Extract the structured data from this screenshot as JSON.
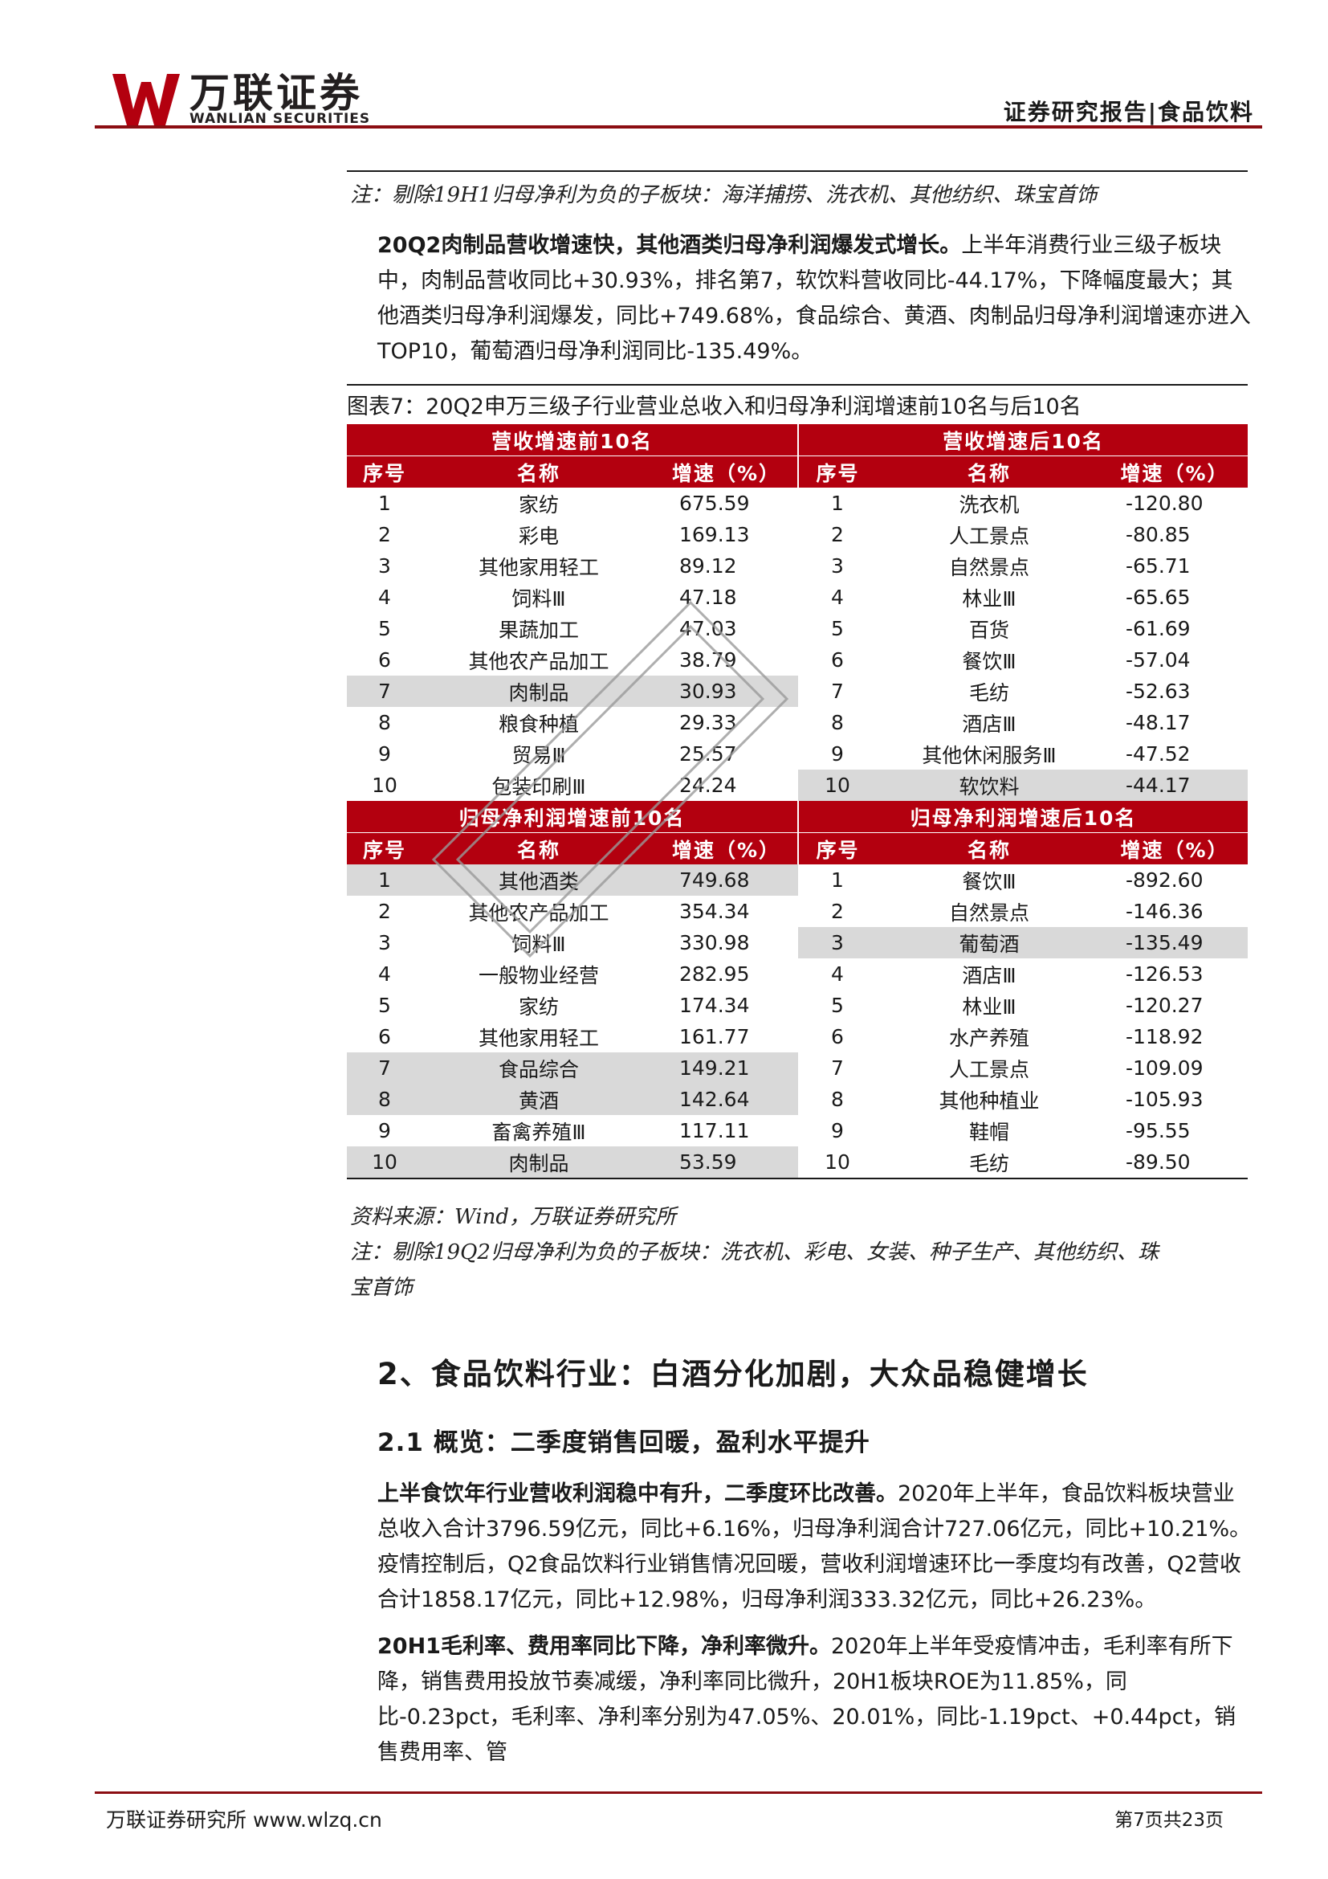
{
  "header": {
    "logo_cn": "万联证券",
    "logo_en": "WANLIAN SECURITIES",
    "right_title": "证券研究报告|食品饮料"
  },
  "note1": "注：剔除19H1归母净利为负的子板块：海洋捕捞、洗衣机、其他纺织、珠宝首饰",
  "para1": {
    "bold": "20Q2肉制品营收增速快，其他酒类归母净利润爆发式增长。",
    "text": "上半年消费行业三级子板块中，肉制品营收同比+30.93%，排名第7，软饮料营收同比-44.17%，下降幅度最大；其他酒类归母净利润爆发，同比+749.68%，食品综合、黄酒、肉制品归母净利润增速亦进入TOP10，葡萄酒归母净利润同比-135.49%。"
  },
  "figure_title": "图表7：20Q2申万三级子行业营业总收入和归母净利润增速前10名与后10名",
  "table": {
    "sec1_left": "营收增速前10名",
    "sec1_right": "营收增速后10名",
    "sec2_left": "归母净利润增速前10名",
    "sec2_right": "归母净利润增速后10名",
    "col_idx": "序号",
    "col_name": "名称",
    "col_rate": "增速（%）",
    "rev_top": [
      {
        "i": "1",
        "n": "家纺",
        "v": "675.59",
        "h": false
      },
      {
        "i": "2",
        "n": "彩电",
        "v": "169.13",
        "h": false
      },
      {
        "i": "3",
        "n": "其他家用轻工",
        "v": "89.12",
        "h": false
      },
      {
        "i": "4",
        "n": "饲料Ⅲ",
        "v": "47.18",
        "h": false
      },
      {
        "i": "5",
        "n": "果蔬加工",
        "v": "47.03",
        "h": false
      },
      {
        "i": "6",
        "n": "其他农产品加工",
        "v": "38.79",
        "h": false
      },
      {
        "i": "7",
        "n": "肉制品",
        "v": "30.93",
        "h": true
      },
      {
        "i": "8",
        "n": "粮食种植",
        "v": "29.33",
        "h": false
      },
      {
        "i": "9",
        "n": "贸易Ⅲ",
        "v": "25.57",
        "h": false
      },
      {
        "i": "10",
        "n": "包装印刷Ⅲ",
        "v": "24.24",
        "h": false
      }
    ],
    "rev_bottom": [
      {
        "i": "1",
        "n": "洗衣机",
        "v": "-120.80",
        "h": false
      },
      {
        "i": "2",
        "n": "人工景点",
        "v": "-80.85",
        "h": false
      },
      {
        "i": "3",
        "n": "自然景点",
        "v": "-65.71",
        "h": false
      },
      {
        "i": "4",
        "n": "林业Ⅲ",
        "v": "-65.65",
        "h": false
      },
      {
        "i": "5",
        "n": "百货",
        "v": "-61.69",
        "h": false
      },
      {
        "i": "6",
        "n": "餐饮Ⅲ",
        "v": "-57.04",
        "h": false
      },
      {
        "i": "7",
        "n": "毛纺",
        "v": "-52.63",
        "h": false
      },
      {
        "i": "8",
        "n": "酒店Ⅲ",
        "v": "-48.17",
        "h": false
      },
      {
        "i": "9",
        "n": "其他休闲服务Ⅲ",
        "v": "-47.52",
        "h": false
      },
      {
        "i": "10",
        "n": "软饮料",
        "v": "-44.17",
        "h": true
      }
    ],
    "np_top": [
      {
        "i": "1",
        "n": "其他酒类",
        "v": "749.68",
        "h": true
      },
      {
        "i": "2",
        "n": "其他农产品加工",
        "v": "354.34",
        "h": false
      },
      {
        "i": "3",
        "n": "饲料Ⅲ",
        "v": "330.98",
        "h": false
      },
      {
        "i": "4",
        "n": "一般物业经营",
        "v": "282.95",
        "h": false
      },
      {
        "i": "5",
        "n": "家纺",
        "v": "174.34",
        "h": false
      },
      {
        "i": "6",
        "n": "其他家用轻工",
        "v": "161.77",
        "h": false
      },
      {
        "i": "7",
        "n": "食品综合",
        "v": "149.21",
        "h": true
      },
      {
        "i": "8",
        "n": "黄酒",
        "v": "142.64",
        "h": true
      },
      {
        "i": "9",
        "n": "畜禽养殖Ⅲ",
        "v": "117.11",
        "h": false
      },
      {
        "i": "10",
        "n": "肉制品",
        "v": "53.59",
        "h": true
      }
    ],
    "np_bottom": [
      {
        "i": "1",
        "n": "餐饮Ⅲ",
        "v": "-892.60",
        "h": false
      },
      {
        "i": "2",
        "n": "自然景点",
        "v": "-146.36",
        "h": false
      },
      {
        "i": "3",
        "n": "葡萄酒",
        "v": "-135.49",
        "h": true
      },
      {
        "i": "4",
        "n": "酒店Ⅲ",
        "v": "-126.53",
        "h": false
      },
      {
        "i": "5",
        "n": "林业Ⅲ",
        "v": "-120.27",
        "h": false
      },
      {
        "i": "6",
        "n": "水产养殖",
        "v": "-118.92",
        "h": false
      },
      {
        "i": "7",
        "n": "人工景点",
        "v": "-109.09",
        "h": false
      },
      {
        "i": "8",
        "n": "其他种植业",
        "v": "-105.93",
        "h": false
      },
      {
        "i": "9",
        "n": "鞋帽",
        "v": "-95.55",
        "h": false
      },
      {
        "i": "10",
        "n": "毛纺",
        "v": "-89.50",
        "h": false
      }
    ]
  },
  "source": "资料来源：Wind，万联证券研究所",
  "note2_line1": "注：剔除19Q2归母净利为负的子板块：洗衣机、彩电、女装、种子生产、其他纺织、珠",
  "note2_line2": "宝首饰",
  "h2": "2、食品饮料行业：白酒分化加剧，大众品稳健增长",
  "h3": "2.1 概览：二季度销售回暖，盈利水平提升",
  "para2": {
    "bold": "上半食饮年行业营收利润稳中有升，二季度环比改善。",
    "text": "2020年上半年，食品饮料板块营业总收入合计3796.59亿元，同比+6.16%，归母净利润合计727.06亿元，同比+10.21%。疫情控制后，Q2食品饮料行业销售情况回暖，营收利润增速环比一季度均有改善，Q2营收合计1858.17亿元，同比+12.98%，归母净利润333.32亿元，同比+26.23%。"
  },
  "para3": {
    "bold": "20H1毛利率、费用率同比下降，净利率微升。",
    "text": "2020年上半年受疫情冲击，毛利率有所下降，销售费用投放节奏减缓，净利率同比微升，20H1板块ROE为11.85%，同比-0.23pct，毛利率、净利率分别为47.05%、20.01%，同比-1.19pct、+0.44pct，销售费用率、管"
  },
  "footer": {
    "left": "万联证券研究所 www.wlzq.cn",
    "right": "第7页共23页"
  },
  "colors": {
    "brand_red": "#b3000f",
    "rule_red": "#8b0d12",
    "highlight": "#d9d9d9"
  }
}
